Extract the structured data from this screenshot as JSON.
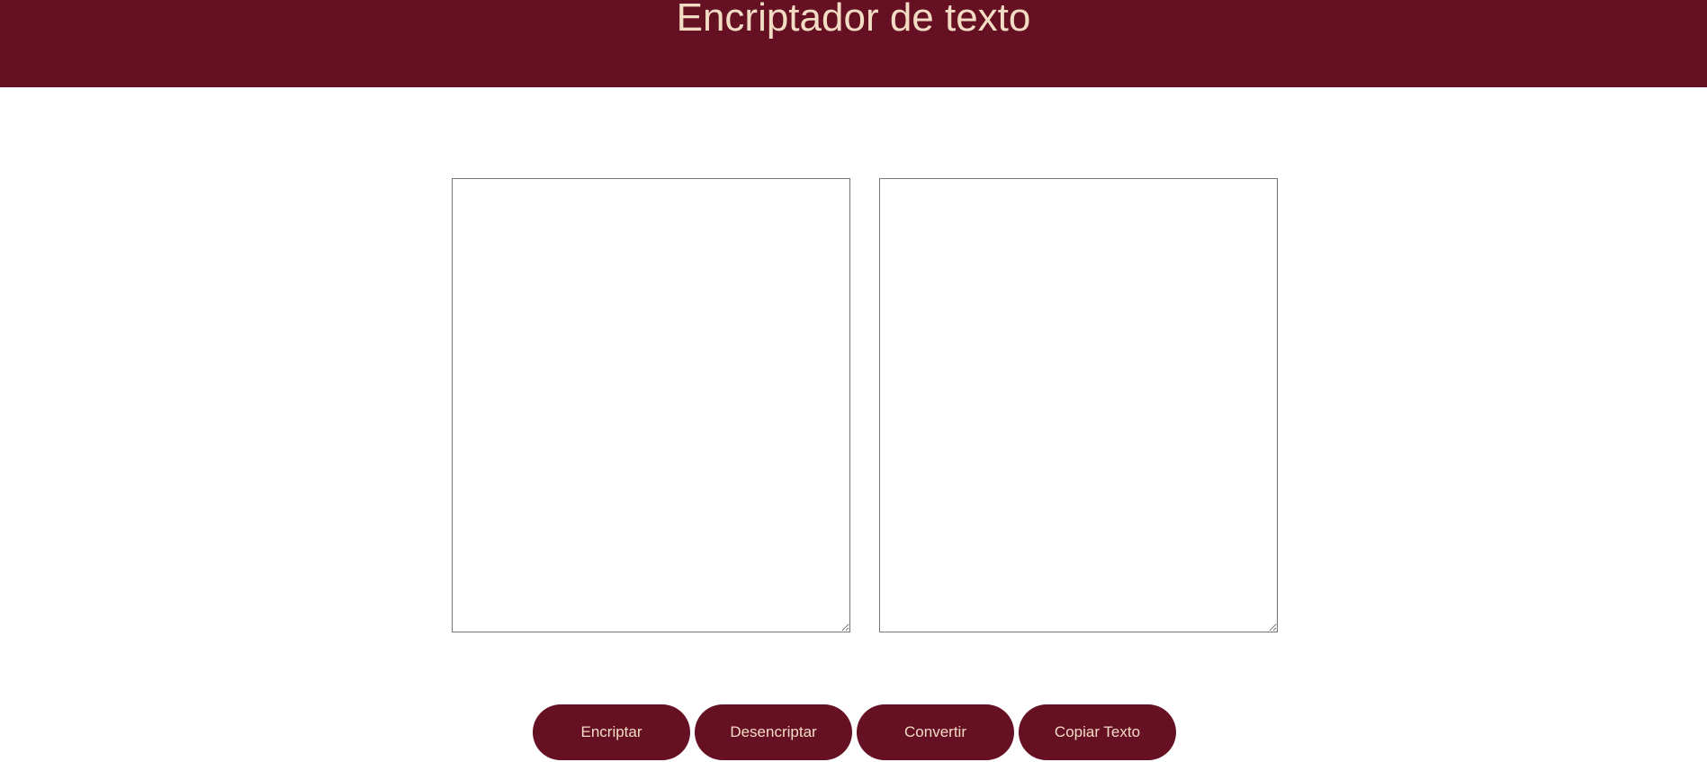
{
  "header": {
    "title": "Encriptador de texto"
  },
  "editor": {
    "input_value": "",
    "output_value": ""
  },
  "buttons": {
    "encrypt_label": "Encriptar",
    "decrypt_label": "Desencriptar",
    "convert_label": "Convertir",
    "copy_label": "Copiar Texto"
  },
  "colors": {
    "brand": "#661024",
    "brand_text": "#f2dcc4",
    "background": "#ffffff"
  }
}
